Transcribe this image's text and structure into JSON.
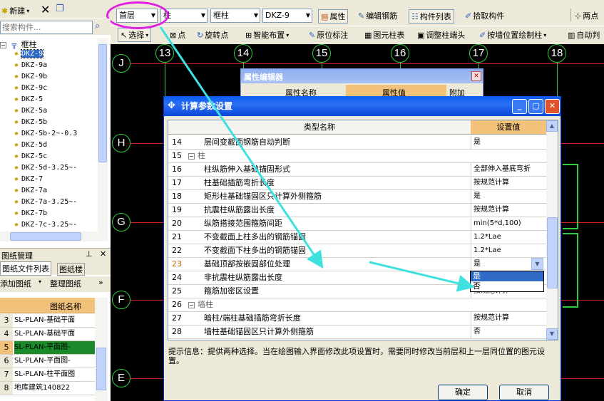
{
  "top_toolbar": {
    "new_label": "新建",
    "layer_value": "首层",
    "type_value": "柱",
    "subtype_value": "框柱",
    "component_value": "DKZ-9",
    "attr_label": "属性",
    "edit_rebar_label": "编辑钢筋",
    "component_list_label": "构件列表",
    "pick_label": "拾取构件",
    "two_point_label": "两点"
  },
  "second_toolbar": {
    "select_label": "选择",
    "point_label": "点",
    "rotate_point_label": "旋转点",
    "smart_layout_label": "智能布置",
    "orig_annot_label": "原位标注",
    "figure_column_table_label": "图元柱表",
    "adjust_column_end_label": "调整柱端头",
    "wall_position_label": "按墙位置绘制柱",
    "auto_label": "自动判"
  },
  "left_panel": {
    "search_placeholder": "搜索构件...",
    "tree_root": "框柱",
    "items": [
      "DKZ-9",
      "DKZ-9a",
      "DKZ-9b",
      "DKZ-9c",
      "DKZ-5",
      "DKZ-5a",
      "DKZ-5b",
      "DKZ-5b-2~-0.3",
      "DKZ-5d",
      "DKZ-5c",
      "DKZ-5d-3.25~-",
      "DKZ-7",
      "DKZ-7a",
      "DKZ-7a-3.25~-",
      "DKZ-7b",
      "DKZ-7c-3.25~-"
    ]
  },
  "drawing_panel": {
    "title": "图纸管理",
    "tab_file_list": "图纸文件列表",
    "tab_layers": "图纸楼",
    "add_label": "添加图纸",
    "organize_label": "整理图纸",
    "column_header": "图纸名称",
    "rows": [
      {
        "num": "3",
        "name": "SL-PLAN-基础平面"
      },
      {
        "num": "4",
        "name": "SL-PLAN-基础平面"
      },
      {
        "num": "5",
        "name": "SL-PLAN-平面图-"
      },
      {
        "num": "6",
        "name": "SL-PLAN-平面图-"
      },
      {
        "num": "7",
        "name": "SL-PLAN-柱平面图"
      },
      {
        "num": "8",
        "name": "地库建筑140822"
      }
    ]
  },
  "cad": {
    "col_axes": [
      "13",
      "14",
      "15",
      "16",
      "17",
      "18"
    ],
    "row_axes": [
      "J",
      "H",
      "G",
      "F",
      "E"
    ]
  },
  "property_editor": {
    "title": "属性编辑器",
    "col_name": "属性名称",
    "col_value": "属性值",
    "col_extra": "附加"
  },
  "dialog": {
    "title": "计算参数设置",
    "col_type_name": "类型名称",
    "col_setting": "设置值",
    "rows": [
      {
        "num": "14",
        "name": "层间变截面钢筋自动判断",
        "value": "是",
        "group": false
      },
      {
        "num": "15",
        "name": "柱",
        "value": "",
        "group": true
      },
      {
        "num": "16",
        "name": "柱纵筋伸入基础锚固形式",
        "value": "全部伸入基底弯折",
        "group": false
      },
      {
        "num": "17",
        "name": "柱基础插筋弯折长度",
        "value": "按规范计算",
        "group": false
      },
      {
        "num": "18",
        "name": "矩形柱基础锚固区只计算外侧箍筋",
        "value": "是",
        "group": false
      },
      {
        "num": "19",
        "name": "抗震柱纵筋露出长度",
        "value": "按规范计算",
        "group": false
      },
      {
        "num": "20",
        "name": "纵筋搭接范围箍筋间距",
        "value": "min(5*d,100)",
        "group": false
      },
      {
        "num": "21",
        "name": "不变截面上柱多出的钢筋锚固",
        "value": "1.2*Lae",
        "group": false
      },
      {
        "num": "22",
        "name": "不变截面下柱多出的钢筋锚固",
        "value": "1.2*Lae",
        "group": false
      },
      {
        "num": "23",
        "name": "基础顶部按嵌固部位处理",
        "value": "是",
        "group": false
      },
      {
        "num": "24",
        "name": "非抗震柱纵筋露出长度",
        "value": "",
        "group": false
      },
      {
        "num": "25",
        "name": "箍筋加密区设置",
        "value": "按规范计算",
        "group": false
      },
      {
        "num": "26",
        "name": "墙柱",
        "value": "",
        "group": true
      },
      {
        "num": "27",
        "name": "暗柱/端柱基础插筋弯折长度",
        "value": "按规范计算",
        "group": false
      },
      {
        "num": "28",
        "name": "墙柱基础锚固区只计算外侧箍筋",
        "value": "否",
        "group": false
      }
    ],
    "dropdown_options": [
      "是",
      "否"
    ],
    "hint": "提示信息：提供两种选择。当在绘图输入界面修改此项设置时，需要同时修改当前层和上一层同位置的图元设置。",
    "ok_label": "确定",
    "cancel_label": "取消"
  },
  "colors": {
    "annotation_cyan": "#3ee0e0",
    "highlight_magenta": "#e020e0",
    "axis_green": "#2ecc40",
    "grid_red": "#cc2020",
    "xp_title_blue": "#0a5cf0"
  }
}
